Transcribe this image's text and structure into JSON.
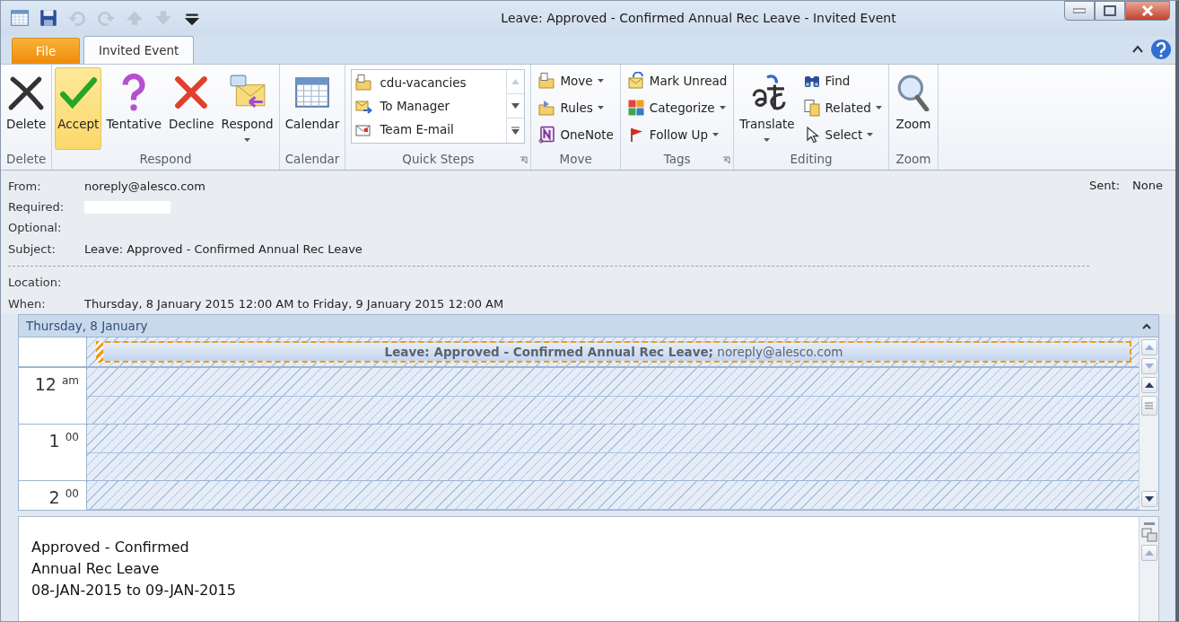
{
  "window": {
    "title": "Leave: Approved - Confirmed Annual Rec Leave  -  Invited Event"
  },
  "quick_access": [
    {
      "enabled": true
    },
    {
      "enabled": true
    },
    {
      "enabled": false
    },
    {
      "enabled": false
    },
    {
      "enabled": false
    },
    {
      "enabled": false
    },
    {
      "enabled": true
    }
  ],
  "tabs": [
    {
      "label": "File",
      "kind": "file",
      "selected": false
    },
    {
      "label": "Invited Event",
      "kind": "tab",
      "selected": true
    }
  ],
  "ribbon": [
    {
      "label": "Delete",
      "launcher": false,
      "items": [
        {
          "kind": "large",
          "label": "Delete",
          "dropdown": false,
          "highlighted": false
        }
      ]
    },
    {
      "label": "Respond",
      "launcher": false,
      "items": [
        {
          "kind": "large",
          "label": "Accept",
          "dropdown": false,
          "highlighted": true
        },
        {
          "kind": "large",
          "label": "Tentative",
          "dropdown": false,
          "highlighted": false
        },
        {
          "kind": "large",
          "label": "Decline",
          "dropdown": false,
          "highlighted": false
        },
        {
          "kind": "large",
          "label": "Respond",
          "dropdown": true,
          "highlighted": false
        }
      ]
    },
    {
      "label": "Calendar",
      "launcher": false,
      "items": [
        {
          "kind": "large",
          "label": "Calendar",
          "dropdown": false,
          "highlighted": false
        }
      ]
    },
    {
      "label": "Quick Steps",
      "launcher": true,
      "items": [
        {
          "kind": "gallery",
          "entries": [
            {
              "label": "cdu-vacancies"
            },
            {
              "label": "To Manager"
            },
            {
              "label": "Team E-mail"
            }
          ]
        }
      ]
    },
    {
      "label": "Move",
      "launcher": false,
      "items": [
        {
          "kind": "small",
          "label": "Move",
          "dropdown": true,
          "highlighted": false
        },
        {
          "kind": "small",
          "label": "Rules",
          "dropdown": true,
          "highlighted": false
        },
        {
          "kind": "small",
          "label": "OneNote",
          "dropdown": false,
          "highlighted": false
        }
      ]
    },
    {
      "label": "Tags",
      "launcher": true,
      "items": [
        {
          "kind": "small",
          "label": "Mark Unread",
          "dropdown": false,
          "highlighted": false
        },
        {
          "kind": "small",
          "label": "Categorize",
          "dropdown": true,
          "highlighted": false
        },
        {
          "kind": "small",
          "label": "Follow Up",
          "dropdown": true,
          "highlighted": false
        }
      ]
    },
    {
      "label": "Editing",
      "launcher": false,
      "items": [
        {
          "kind": "large",
          "label": "Translate",
          "dropdown": true,
          "highlighted": false
        },
        {
          "kind": "small",
          "label": "Find",
          "dropdown": false,
          "highlighted": false
        },
        {
          "kind": "small",
          "label": "Related",
          "dropdown": true,
          "highlighted": false
        },
        {
          "kind": "small",
          "label": "Select",
          "dropdown": true,
          "highlighted": false
        }
      ]
    },
    {
      "label": "Zoom",
      "launcher": false,
      "items": [
        {
          "kind": "large",
          "label": "Zoom",
          "dropdown": false,
          "highlighted": false
        }
      ]
    }
  ],
  "header": {
    "fields": [
      {
        "label": "From:",
        "kind": "text",
        "value": "noreply@alesco.com"
      },
      {
        "label": "Required:",
        "kind": "redacted"
      },
      {
        "label": "Optional:",
        "kind": "empty"
      },
      {
        "label": "Subject:",
        "kind": "text",
        "value": "Leave: Approved - Confirmed Annual Rec Leave"
      },
      {
        "kind": "separator"
      },
      {
        "label": "Location:",
        "kind": "empty"
      },
      {
        "label": "When:",
        "kind": "text",
        "value": "Thursday, 8 January 2015 12:00 AM to Friday, 9 January 2015 12:00 AM"
      }
    ],
    "sent": {
      "label": "Sent:",
      "value": "None"
    }
  },
  "calendar": {
    "day": "Thursday, 8 January",
    "all_day_event": "**Leave: Approved - Confirmed Annual Rec Leave;** noreply@alesco.com",
    "hours": [
      {
        "hour": "12",
        "suffix": "am"
      },
      {
        "hour": "1",
        "suffix": "00"
      },
      {
        "hour": "2",
        "suffix": "00"
      }
    ]
  },
  "body": {
    "lines": [
      "Approved - Confirmed",
      "Annual Rec Leave",
      "08-JAN-2015 to 09-JAN-2015"
    ]
  }
}
